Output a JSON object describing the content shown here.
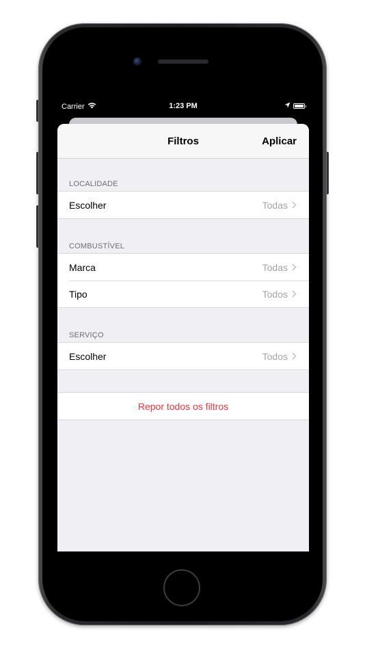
{
  "status_bar": {
    "carrier": "Carrier",
    "time": "1:23 PM",
    "icons": [
      "wifi-icon",
      "location-arrow-icon",
      "battery-icon"
    ]
  },
  "nav": {
    "title": "Filtros",
    "apply_label": "Aplicar"
  },
  "sections": [
    {
      "header": "LOCALIDADE",
      "rows": [
        {
          "label": "Escolher",
          "value": "Todas"
        }
      ]
    },
    {
      "header": "COMBUSTÍVEL",
      "rows": [
        {
          "label": "Marca",
          "value": "Todas"
        },
        {
          "label": "Tipo",
          "value": "Todos"
        }
      ]
    },
    {
      "header": "SERVIÇO",
      "rows": [
        {
          "label": "Escolher",
          "value": "Todos"
        }
      ]
    }
  ],
  "reset_label": "Repor todos os filtros",
  "colors": {
    "destructive": "#e6393d",
    "secondary_text": "#a4a4a8",
    "grouped_background": "#efeff4"
  }
}
